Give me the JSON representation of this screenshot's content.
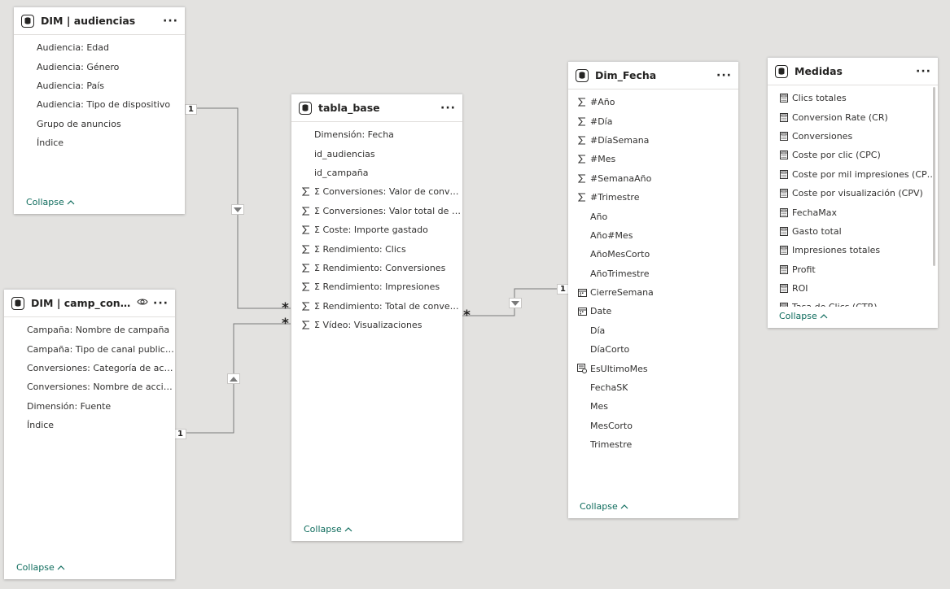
{
  "tables": {
    "audiencias": {
      "title": "DIM | audiencias",
      "fields": [
        "Audiencia: Edad",
        "Audiencia: Género",
        "Audiencia: País",
        "Audiencia: Tipo de dispositivo",
        "Grupo de anuncios",
        "Índice"
      ],
      "collapse": "Collapse"
    },
    "camp": {
      "title": "DIM | camp_conv_f...",
      "fields": [
        "Campaña: Nombre de campaña",
        "Campaña: Tipo de canal publicitario",
        "Conversiones: Categoría de acción...",
        "Conversiones: Nombre de acción ...",
        "Dimensión: Fuente",
        "Índice"
      ],
      "collapse": "Collapse"
    },
    "tabla_base": {
      "title": "tabla_base",
      "fields": [
        {
          "text": "Dimensión: Fecha",
          "icon": ""
        },
        {
          "text": "id_audiencias",
          "icon": ""
        },
        {
          "text": "id_campaña",
          "icon": ""
        },
        {
          "text": "Σ Conversiones: Valor de conversi...",
          "icon": "sum"
        },
        {
          "text": "Σ Conversiones: Valor total de con...",
          "icon": "sum"
        },
        {
          "text": "Σ Coste: Importe gastado",
          "icon": "sum"
        },
        {
          "text": "Σ Rendimiento: Clics",
          "icon": "sum"
        },
        {
          "text": "Σ Rendimiento: Conversiones",
          "icon": "sum"
        },
        {
          "text": "Σ Rendimiento: Impresiones",
          "icon": "sum"
        },
        {
          "text": "Σ Rendimiento: Total de conversio...",
          "icon": "sum"
        },
        {
          "text": "Σ Vídeo: Visualizaciones",
          "icon": "sum"
        }
      ],
      "collapse": "Collapse"
    },
    "dim_fecha": {
      "title": "Dim_Fecha",
      "fields": [
        {
          "text": "#Año",
          "icon": "sum"
        },
        {
          "text": "#Día",
          "icon": "sum"
        },
        {
          "text": "#DíaSemana",
          "icon": "sum"
        },
        {
          "text": "#Mes",
          "icon": "sum"
        },
        {
          "text": "#SemanaAño",
          "icon": "sum"
        },
        {
          "text": "#Trimestre",
          "icon": "sum"
        },
        {
          "text": "Año",
          "icon": ""
        },
        {
          "text": "Año#Mes",
          "icon": ""
        },
        {
          "text": "AñoMesCorto",
          "icon": ""
        },
        {
          "text": "AñoTrimestre",
          "icon": ""
        },
        {
          "text": "CierreSemana",
          "icon": "calendar"
        },
        {
          "text": "Date",
          "icon": "calendar"
        },
        {
          "text": "Día",
          "icon": ""
        },
        {
          "text": "DíaCorto",
          "icon": ""
        },
        {
          "text": "EsUltimoMes",
          "icon": "boolean"
        },
        {
          "text": "FechaSK",
          "icon": ""
        },
        {
          "text": "Mes",
          "icon": ""
        },
        {
          "text": "MesCorto",
          "icon": ""
        },
        {
          "text": "Trimestre",
          "icon": ""
        }
      ],
      "collapse": "Collapse"
    },
    "medidas": {
      "title": "Medidas",
      "fields": [
        "Clics totales",
        "Conversion Rate (CR)",
        "Conversiones",
        "Coste por clic (CPC)",
        "Coste por mil impresiones (CPM)",
        "Coste por visualización (CPV)",
        "FechaMax",
        "Gasto total",
        "Impresiones totales",
        "Profit",
        "ROI",
        "Tasa de Clics (CTR)"
      ],
      "collapse": "Collapse"
    }
  },
  "relationships": {
    "one_label": "1",
    "many_label": "*"
  },
  "icons": {
    "table": "database-icon",
    "more": "more-options-icon",
    "eye": "eye-icon",
    "sum": "sigma-icon",
    "calendar": "calendar-icon",
    "measure": "calculator-icon",
    "chevron": "chevron-up-icon"
  },
  "colors": {
    "canvas": "#e3e2e0",
    "accent": "#0f6c5d",
    "line": "#7a7a7a"
  }
}
